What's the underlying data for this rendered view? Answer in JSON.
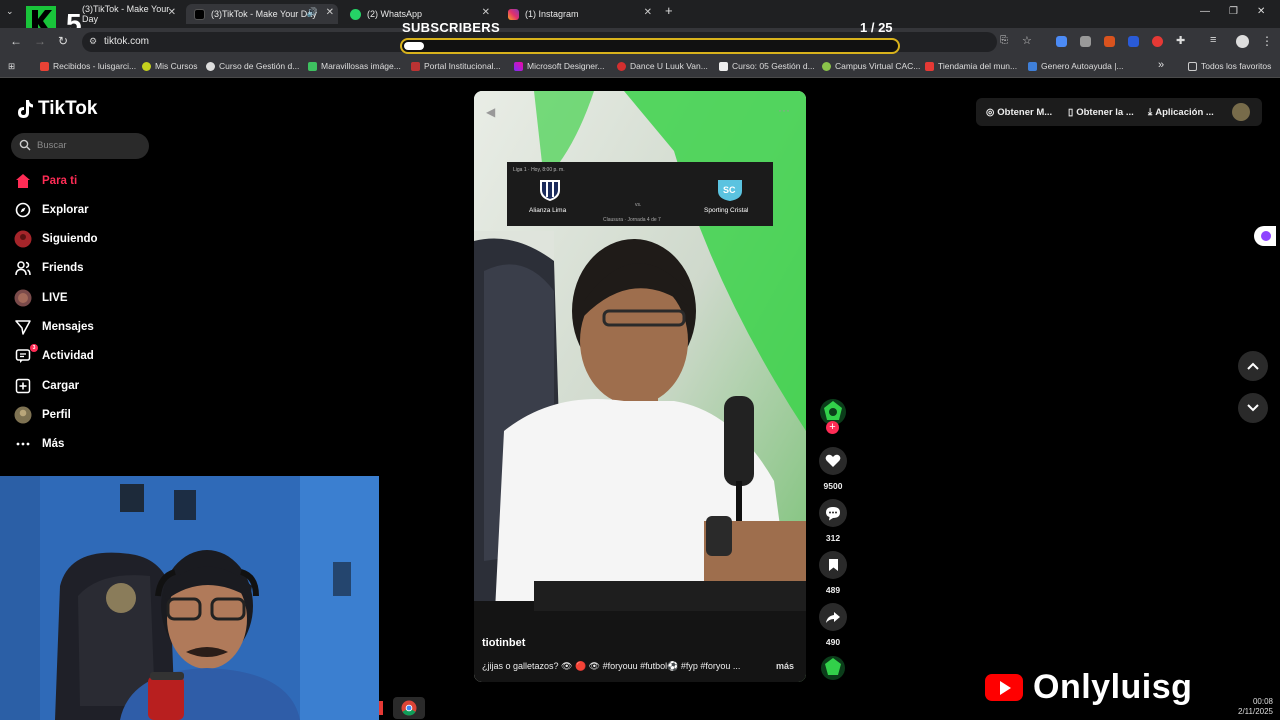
{
  "browser": {
    "tabs": [
      {
        "label": "(3)TikTok - Make Your Day"
      },
      {
        "label": "(3)TikTok - Make Your Day"
      },
      {
        "label": "(2) WhatsApp"
      },
      {
        "label": "(1) Instagram"
      }
    ],
    "url": "tiktok.com",
    "bookmarks": [
      "Recibidos - luisgarci...",
      "Mis Cursos",
      "Curso de Gestión d...",
      "Maravillosas imáge...",
      "Portal Institucional...",
      "Microsoft Designer...",
      "Dance U Luuk Van...",
      "Curso: 05 Gestión d...",
      "Campus Virtual CAC...",
      "Tiendamia del mun...",
      "Genero Autoayuda |...",
      "Todos los favoritos"
    ]
  },
  "overlay": {
    "subscribers_label": "SUBSCRIBERS",
    "subscribers_count": "1 / 25",
    "progress_fraction": 0.04,
    "logo_text": "5"
  },
  "tiktok": {
    "logo": "TikTok",
    "search_placeholder": "Buscar",
    "nav": [
      {
        "label": "Para ti",
        "icon": "home-icon"
      },
      {
        "label": "Explorar",
        "icon": "compass-icon"
      },
      {
        "label": "Siguiendo",
        "icon": "following-icon"
      },
      {
        "label": "Friends",
        "icon": "friends-icon"
      },
      {
        "label": "LIVE",
        "icon": "live-icon"
      },
      {
        "label": "Mensajes",
        "icon": "messages-icon"
      },
      {
        "label": "Actividad",
        "icon": "activity-icon",
        "badge": "3"
      },
      {
        "label": "Cargar",
        "icon": "upload-icon"
      },
      {
        "label": "Perfil",
        "icon": "profile-icon"
      },
      {
        "label": "Más",
        "icon": "more-icon"
      }
    ],
    "top_buttons": [
      "Obtener M...",
      "Obtener la ...",
      "Aplicación ..."
    ],
    "video": {
      "scoreboard": {
        "league": "Liga 1 · Hoy, 8:00 p. m.",
        "home": "Alianza Lima",
        "vs": "vs.",
        "away": "Sporting Cristal",
        "meta": "Clausura · Jornada 4 de 7"
      },
      "author": "tiotinbet",
      "caption": "¿jijas o galletazos? 👁 🔴 👁 #foryouu #futbol⚽ #fyp #foryou ...",
      "more": "más"
    },
    "actions": {
      "likes": "9500",
      "comments": "312",
      "saves": "489",
      "shares": "490"
    }
  },
  "taskbar": {
    "time": "00:08",
    "date": "2/11/2025"
  },
  "brand": {
    "channel": "Onlyluisg"
  }
}
